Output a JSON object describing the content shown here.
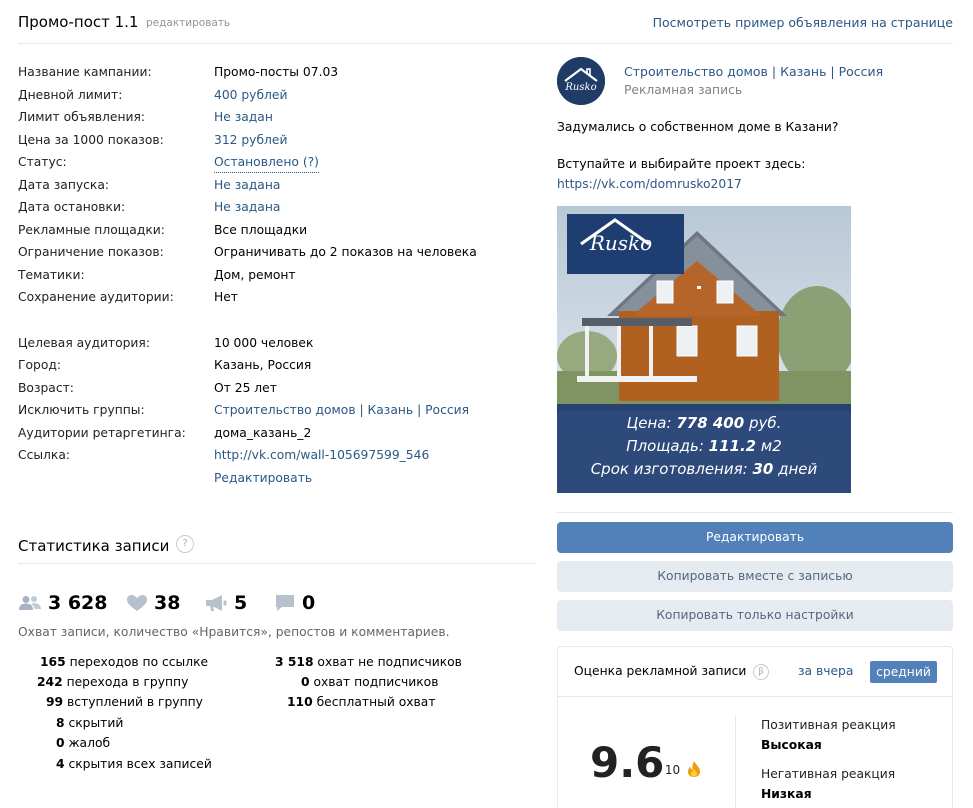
{
  "header": {
    "title": "Промо-пост 1.1",
    "edit_link": "редактировать",
    "preview_link": "Посмотреть пример объявления на странице"
  },
  "details": [
    {
      "label": "Название кампании:",
      "value": "Промо-посты 07.03",
      "link": false
    },
    {
      "label": "Дневной лимит:",
      "value": "400 рублей",
      "link": true
    },
    {
      "label": "Лимит объявления:",
      "value": "Не задан",
      "link": true
    },
    {
      "label": "Цена за 1000 показов:",
      "value": "312 рублей",
      "link": true
    },
    {
      "label": "Статус:",
      "value": "Остановлено (?)",
      "link": true
    },
    {
      "label": "Дата запуска:",
      "value": "Не задана",
      "link": true
    },
    {
      "label": "Дата остановки:",
      "value": "Не задана",
      "link": true
    },
    {
      "label": "Рекламные площадки:",
      "value": "Все площадки",
      "link": false
    },
    {
      "label": "Ограничение показов:",
      "value": "Ограничивать до 2 показов на человека",
      "link": false
    },
    {
      "label": "Тематики:",
      "value": "Дом, ремонт",
      "link": false
    },
    {
      "label": "Сохранение аудитории:",
      "value": "Нет",
      "link": false
    }
  ],
  "targeting": [
    {
      "label": "Целевая аудитория:",
      "value": "10 000 человек",
      "link": false
    },
    {
      "label": "Город:",
      "value": "Казань, Россия",
      "link": false
    },
    {
      "label": "Возраст:",
      "value": "От 25 лет",
      "link": false
    },
    {
      "label": "Исключить группы:",
      "value": "Строительство домов | Казань | Россия",
      "link": true
    },
    {
      "label": "Аудитории ретаргетинга:",
      "value": "дома_казань_2",
      "link": false
    },
    {
      "label": "Ссылка:",
      "value": "http://vk.com/wall-105697599_546",
      "link": true
    },
    {
      "label": "",
      "value": "Редактировать",
      "link": true
    }
  ],
  "stats": {
    "title": "Статистика записи",
    "help": "?",
    "reach": "3 628",
    "likes": "38",
    "reposts": "5",
    "comments": "0",
    "description": "Охват записи, количество «Нравится», репостов и комментариев.",
    "left_items": [
      {
        "num": "165",
        "text": " переходов по ссылке"
      },
      {
        "num": "242",
        "text": " перехода в группу"
      },
      {
        "num": "99",
        "text": " вступлений в группу"
      },
      {
        "num": "8",
        "text": " скрытий"
      },
      {
        "num": "0",
        "text": " жалоб"
      },
      {
        "num": "4",
        "text": " скрытия всех записей"
      }
    ],
    "right_items": [
      {
        "num": "3 518",
        "text": " охват не подписчиков"
      },
      {
        "num": "0",
        "text": " охват подписчиков"
      },
      {
        "num": "110",
        "text": " бесплатный охват"
      }
    ]
  },
  "post": {
    "group_name": "Строительство домов | Казань | Россия",
    "group_sub": "Рекламная запись",
    "avatar_text": "Rusko",
    "text1": "Задумались о собственном доме в Казани?",
    "text2": "Вступайте и выбирайте проект здесь:",
    "link": "https://vk.com/domrusko2017",
    "image": {
      "logo": "Rusko",
      "price_label": "Цена: ",
      "price_value": "778 400",
      "price_unit": " руб.",
      "area_label": "Площадь: ",
      "area_value": "111.2",
      "area_unit": " м2",
      "term_label": "Срок изготовления: ",
      "term_value": "30",
      "term_unit": " дней"
    }
  },
  "buttons": {
    "edit": "Редактировать",
    "copy_with_post": "Копировать вместе с записью",
    "copy_settings": "Копировать только настройки"
  },
  "rating": {
    "title": "Оценка рекламной записи",
    "help": "β",
    "period": "за вчера",
    "badge": "средний",
    "score": "9.6",
    "score_of": "/ 10",
    "positive_label": "Позитивная реакция",
    "positive_value": "Высокая",
    "negative_label": "Негативная реакция",
    "negative_value": "Низкая"
  }
}
